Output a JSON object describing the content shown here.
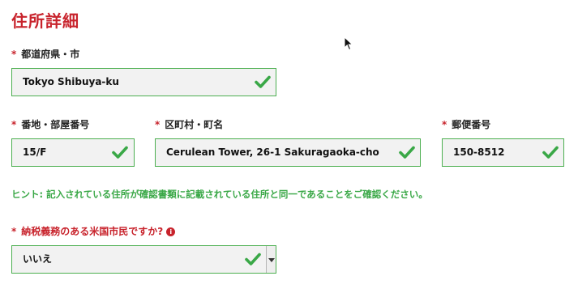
{
  "section_title": "住所詳細",
  "required_mark": "*",
  "fields": {
    "prefecture_city": {
      "label": "都道府県・市",
      "value": "Tokyo Shibuya-ku"
    },
    "street_number": {
      "label": "番地・部屋番号",
      "value": "15/F"
    },
    "ward_town": {
      "label": "区町村・町名",
      "value": "Cerulean Tower, 26-1 Sakuragaoka-cho"
    },
    "postal_code": {
      "label": "郵便番号",
      "value": "150-8512"
    }
  },
  "hint": "ヒント: 記入されている住所が確認書類に記載されている住所と同一であることをご確認ください。",
  "us_taxpayer": {
    "label": "納税義務のある米国市民ですか?",
    "info_icon": "i",
    "selected": "いいえ"
  },
  "colors": {
    "accent_red": "#c8232c",
    "valid_green": "#3aa847",
    "field_border": "#4caf50",
    "field_bg": "#f2f2f2"
  },
  "icons": [
    "checkmark-icon",
    "info-icon",
    "dropdown-arrow-icon",
    "mouse-cursor-icon"
  ]
}
